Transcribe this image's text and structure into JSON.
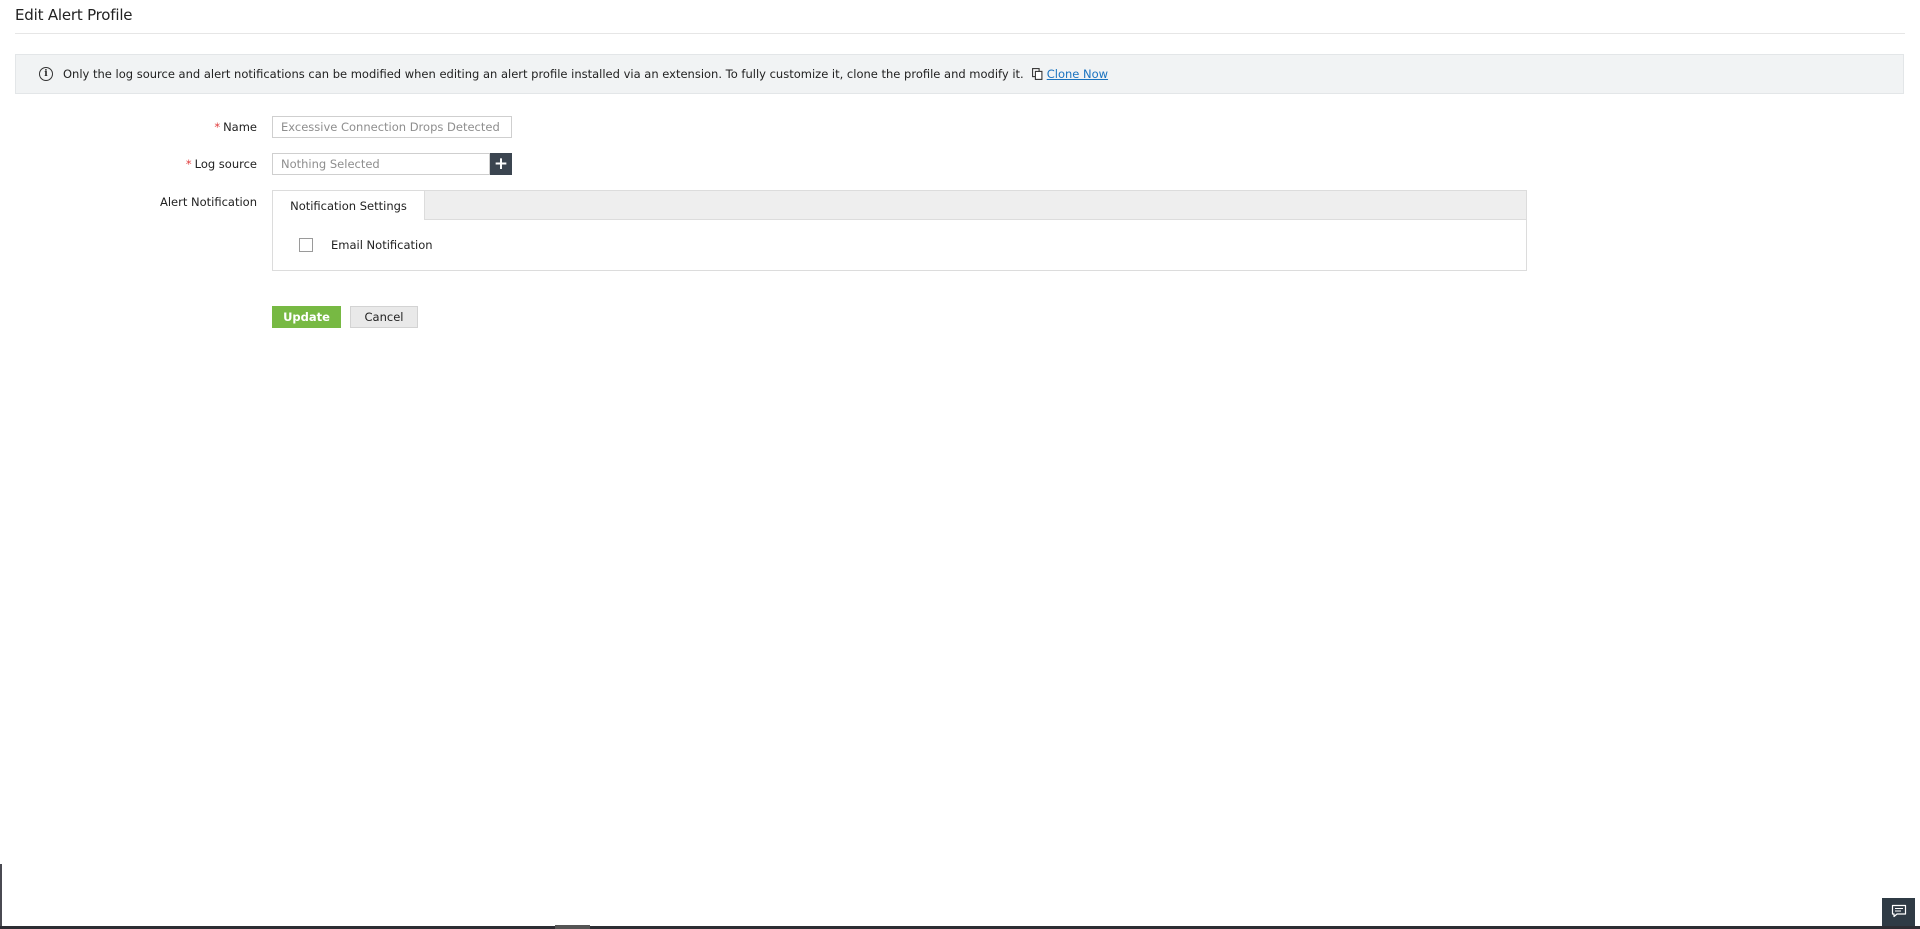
{
  "page": {
    "title": "Edit Alert Profile"
  },
  "banner": {
    "message": "Only the log source and alert notifications can be modified when editing an alert profile installed via an extension. To fully customize it, clone the profile and modify it.",
    "link_label": "Clone Now",
    "info_icon": "info-icon",
    "clone_icon": "copy-icon"
  },
  "form": {
    "required_marker": "*",
    "name": {
      "label": "Name",
      "value": "Excessive Connection Drops Detected"
    },
    "log_source": {
      "label": "Log source",
      "placeholder": "Nothing Selected",
      "add_icon": "+"
    },
    "alert_notification": {
      "label": "Alert Notification",
      "tab_label": "Notification Settings",
      "email_label": "Email Notification",
      "email_checked": false
    }
  },
  "actions": {
    "update_label": "Update",
    "cancel_label": "Cancel"
  },
  "colors": {
    "update_button": "#77b943",
    "link": "#1a73c0",
    "required": "#e03a3a",
    "add_button": "#3b4550",
    "chat_button": "#2f3b45"
  }
}
